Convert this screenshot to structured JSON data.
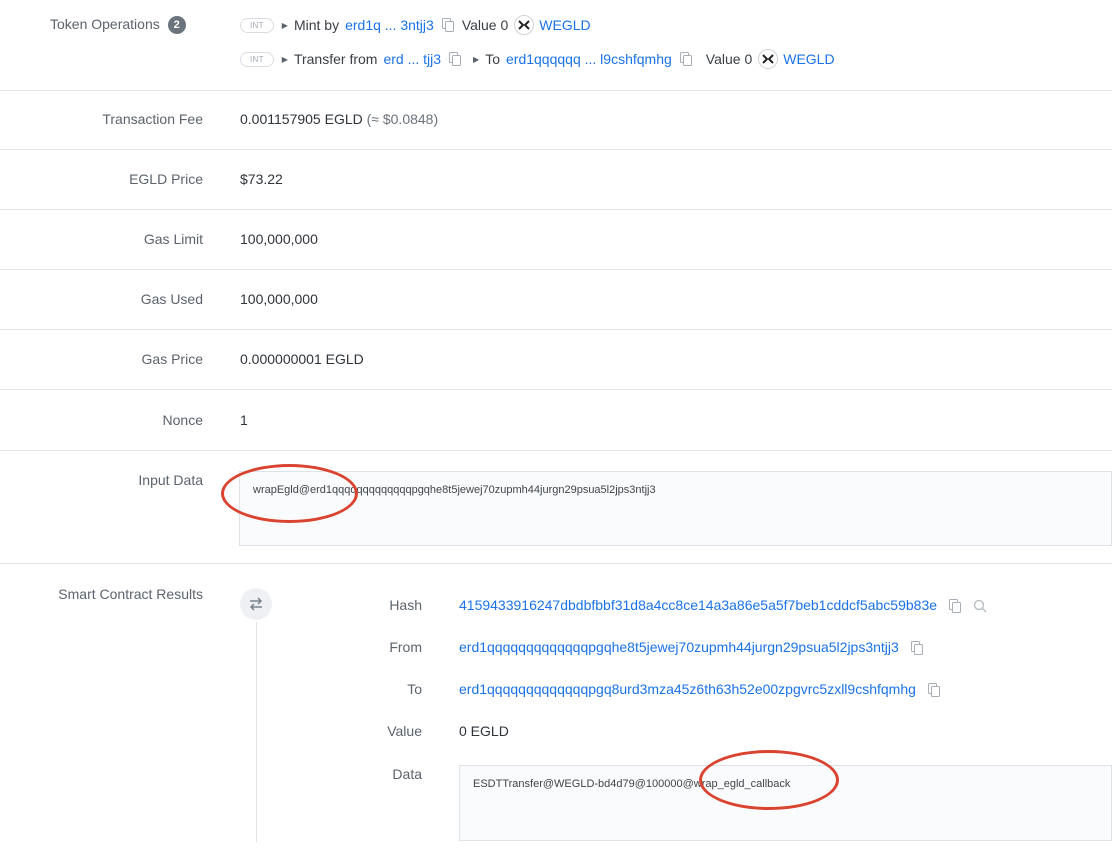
{
  "token_operations": {
    "label": "Token Operations",
    "count": "2",
    "ops": [
      {
        "type": "INT",
        "action": "Mint by",
        "address": "erd1q ... 3ntjj3",
        "value_label": "Value 0",
        "token": "WEGLD"
      },
      {
        "type": "INT",
        "action": "Transfer from",
        "from_address": "erd ... tjj3",
        "to_label": "To",
        "to_address": "erd1qqqqqq ... l9cshfqmhg",
        "value_label": "Value 0",
        "token": "WEGLD"
      }
    ]
  },
  "details": {
    "fee_label": "Transaction Fee",
    "fee_value": "0.001157905 EGLD",
    "fee_usd": "(≈ $0.0848)",
    "price_label": "EGLD Price",
    "price_value": "$73.22",
    "gas_limit_label": "Gas Limit",
    "gas_limit_value": "100,000,000",
    "gas_used_label": "Gas Used",
    "gas_used_value": "100,000,000",
    "gas_price_label": "Gas Price",
    "gas_price_value": "0.000000001 EGLD",
    "nonce_label": "Nonce",
    "nonce_value": "1",
    "input_label": "Input Data",
    "input_value": "wrapEgld@erd1qqqqqqqqqqqqqpgqhe8t5jewej70zupmh44jurgn29psua5l2jps3ntjj3"
  },
  "scr": {
    "label": "Smart Contract Results",
    "hash_label": "Hash",
    "hash_value": "4159433916247dbdbfbbf31d8a4cc8ce14a3a86e5a5f7beb1cddcf5abc59b83e",
    "from_label": "From",
    "from_value": "erd1qqqqqqqqqqqqqpgqhe8t5jewej70zupmh44jurgn29psua5l2jps3ntjj3",
    "to_label": "To",
    "to_value": "erd1qqqqqqqqqqqqqpgq8urd3mza45z6th63h52e00zpgvrc5zxll9cshfqmhg",
    "value_label": "Value",
    "value_value": "0 EGLD",
    "data_label": "Data",
    "data_value": "ESDTTransfer@WEGLD-bd4d79@100000@wrap_egld_callback"
  },
  "colors": {
    "link": "#1a73e8",
    "annotation": "#d9432f",
    "border": "#e3e6ea"
  }
}
